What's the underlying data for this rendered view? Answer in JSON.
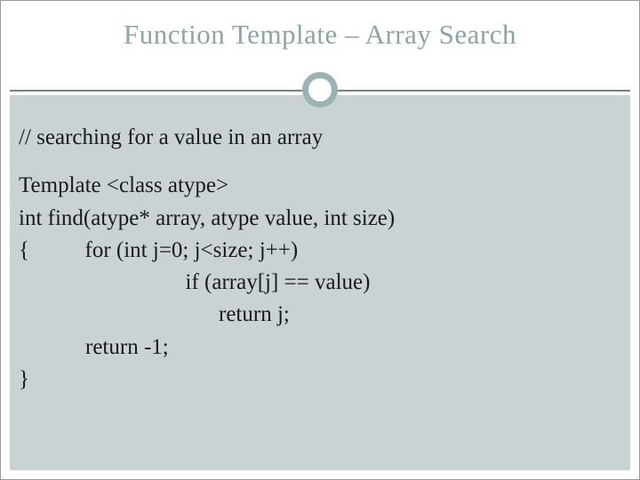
{
  "slide": {
    "title": "Function Template – Array Search",
    "comment": "// searching for a value in an array",
    "code": {
      "l1": "Template <class atype>",
      "l2": "int find(atype* array, atype value, int size)",
      "l3": "{          for (int j=0; j<size; j++)",
      "l4": "                              if (array[j] == value)",
      "l5": "                                    return j;",
      "l6": "            return -1;",
      "l7": "}"
    }
  }
}
